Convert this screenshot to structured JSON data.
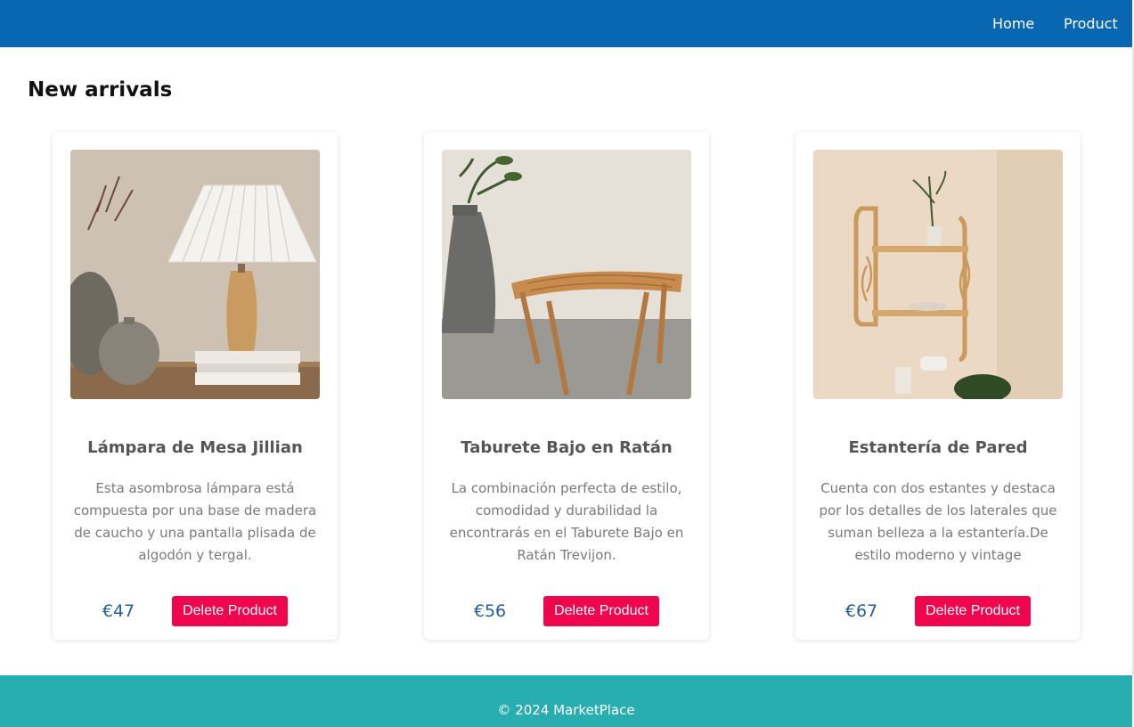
{
  "nav": {
    "links": [
      {
        "label": "Home"
      },
      {
        "label": "Product"
      }
    ]
  },
  "section": {
    "title": "New arrivals"
  },
  "products": [
    {
      "title": "Lámpara de Mesa Jillian",
      "description": "Esta asombrosa lámpara está compuesta por una base de madera de caucho y una pantalla plisada de algodón y tergal.",
      "price": "€47",
      "delete_label": "Delete Product"
    },
    {
      "title": "Taburete Bajo en Ratán",
      "description": "La combinación perfecta de estilo, comodidad y durabilidad la encontrarás en el Taburete Bajo en Ratán Trevijon.",
      "price": "€56",
      "delete_label": "Delete Product"
    },
    {
      "title": "Estantería de Pared",
      "description": "Cuenta con dos estantes y destaca por los detalles de los laterales que suman belleza a la estantería.De estilo moderno y vintage",
      "price": "€67",
      "delete_label": "Delete Product"
    }
  ],
  "footer": {
    "text": "© 2024 MarketPlace"
  },
  "colors": {
    "navbar": "#0867b0",
    "footer": "#28adb0",
    "delete_button": "#f0064d",
    "price": "#1f5ea0"
  }
}
